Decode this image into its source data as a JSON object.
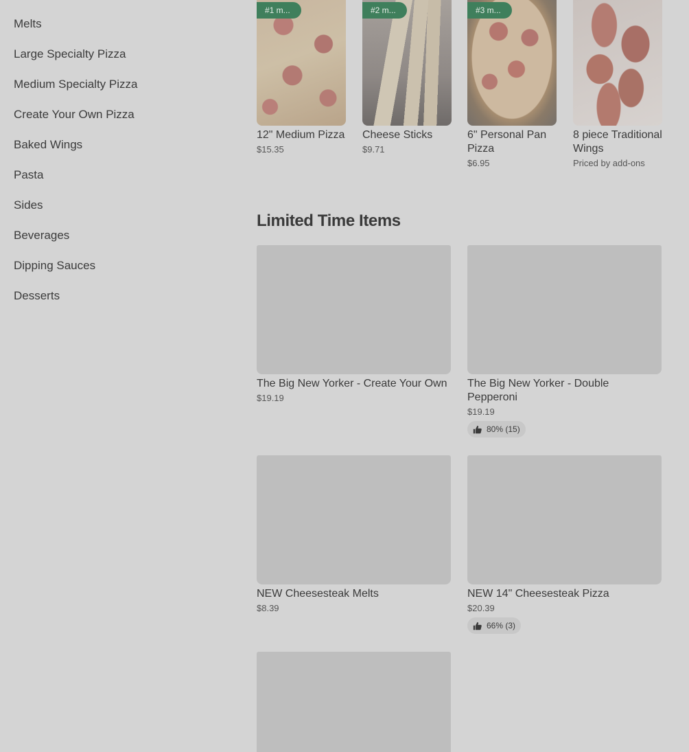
{
  "sidebar": {
    "items": [
      {
        "label": "Melts"
      },
      {
        "label": "Large Specialty Pizza"
      },
      {
        "label": "Medium Specialty Pizza"
      },
      {
        "label": "Create Your Own Pizza"
      },
      {
        "label": "Baked Wings"
      },
      {
        "label": "Pasta"
      },
      {
        "label": "Sides"
      },
      {
        "label": "Beverages"
      },
      {
        "label": "Dipping Sauces"
      },
      {
        "label": "Desserts"
      }
    ]
  },
  "popular": {
    "items": [
      {
        "badge": "#1 m...",
        "title": "12\" Medium Pizza",
        "price": "$15.35"
      },
      {
        "badge": "#2 m...",
        "title": "Cheese Sticks",
        "price": "$9.71"
      },
      {
        "badge": "#3 m...",
        "title": "6\" Personal Pan Pizza",
        "price": "$6.95"
      },
      {
        "title": "8 piece Traditional Wings",
        "price": "Priced by add-ons"
      }
    ]
  },
  "limited": {
    "heading": "Limited Time Items",
    "items": [
      {
        "title": "The Big New Yorker - Create Your Own",
        "price": "$19.19"
      },
      {
        "title": "The Big New Yorker - Double Pepperoni",
        "price": "$19.19",
        "rating": "80% (15)"
      },
      {
        "title": "NEW Cheesesteak Melts",
        "price": "$8.39"
      },
      {
        "title": "NEW 14\" Cheesesteak Pizza",
        "price": "$20.39",
        "rating": "66% (3)"
      },
      {
        "title": ""
      }
    ]
  },
  "icons": {
    "thumbs_up": "thumbs-up-icon"
  },
  "colors": {
    "badge_green": "#3f7f5c",
    "overlay_gray": "#d4d4d4",
    "placeholder": "#bebebe"
  }
}
